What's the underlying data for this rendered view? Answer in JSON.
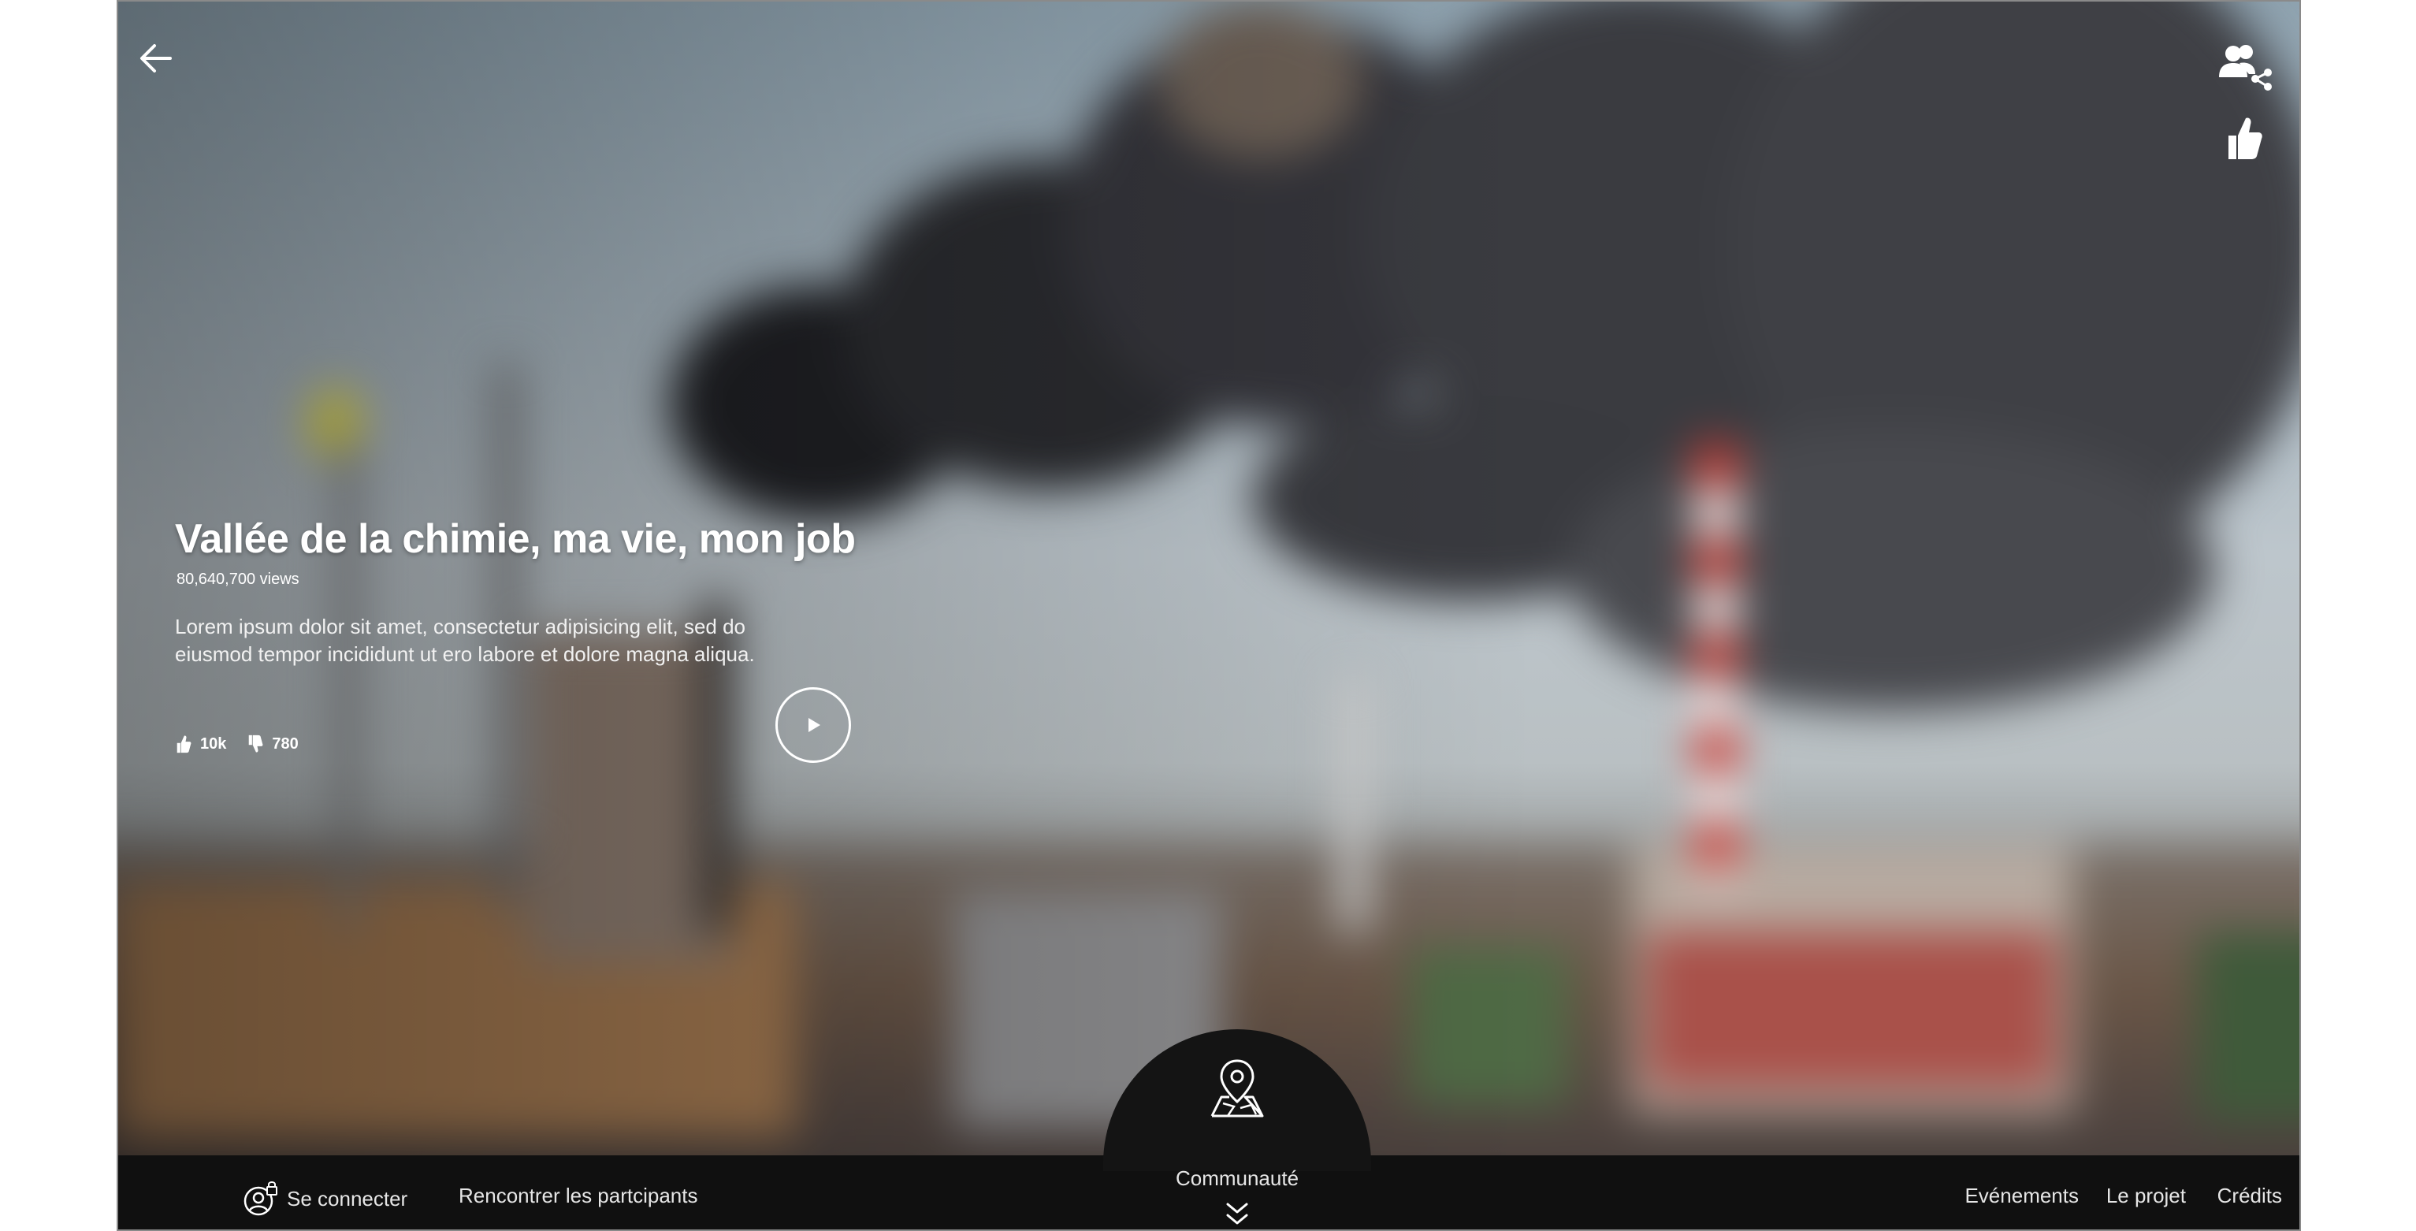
{
  "header": {
    "back_icon": "arrow-left-icon",
    "share_icon": "users-share-icon",
    "like_icon": "thumbs-up-icon"
  },
  "video": {
    "title": "Vallée de la chimie, ma vie, mon job",
    "views": "80,640,700 views",
    "description": "Lorem ipsum dolor sit amet, consectetur adipisicing elit, sed do eiusmod tempor incididunt ut ero labore et dolore magna aliqua.",
    "likes": "10k",
    "dislikes": "780",
    "play_icon": "play-icon"
  },
  "footer": {
    "login_label": "Se connecter",
    "meet_label": "Rencontrer les partcipants",
    "community_label": "Communauté",
    "community_icon": "map-pin-icon",
    "events_label": "Evénements",
    "project_label": "Le projet",
    "credits_label": "Crédits"
  },
  "colors": {
    "footer_bg": "#101010",
    "text": "#ffffff"
  }
}
